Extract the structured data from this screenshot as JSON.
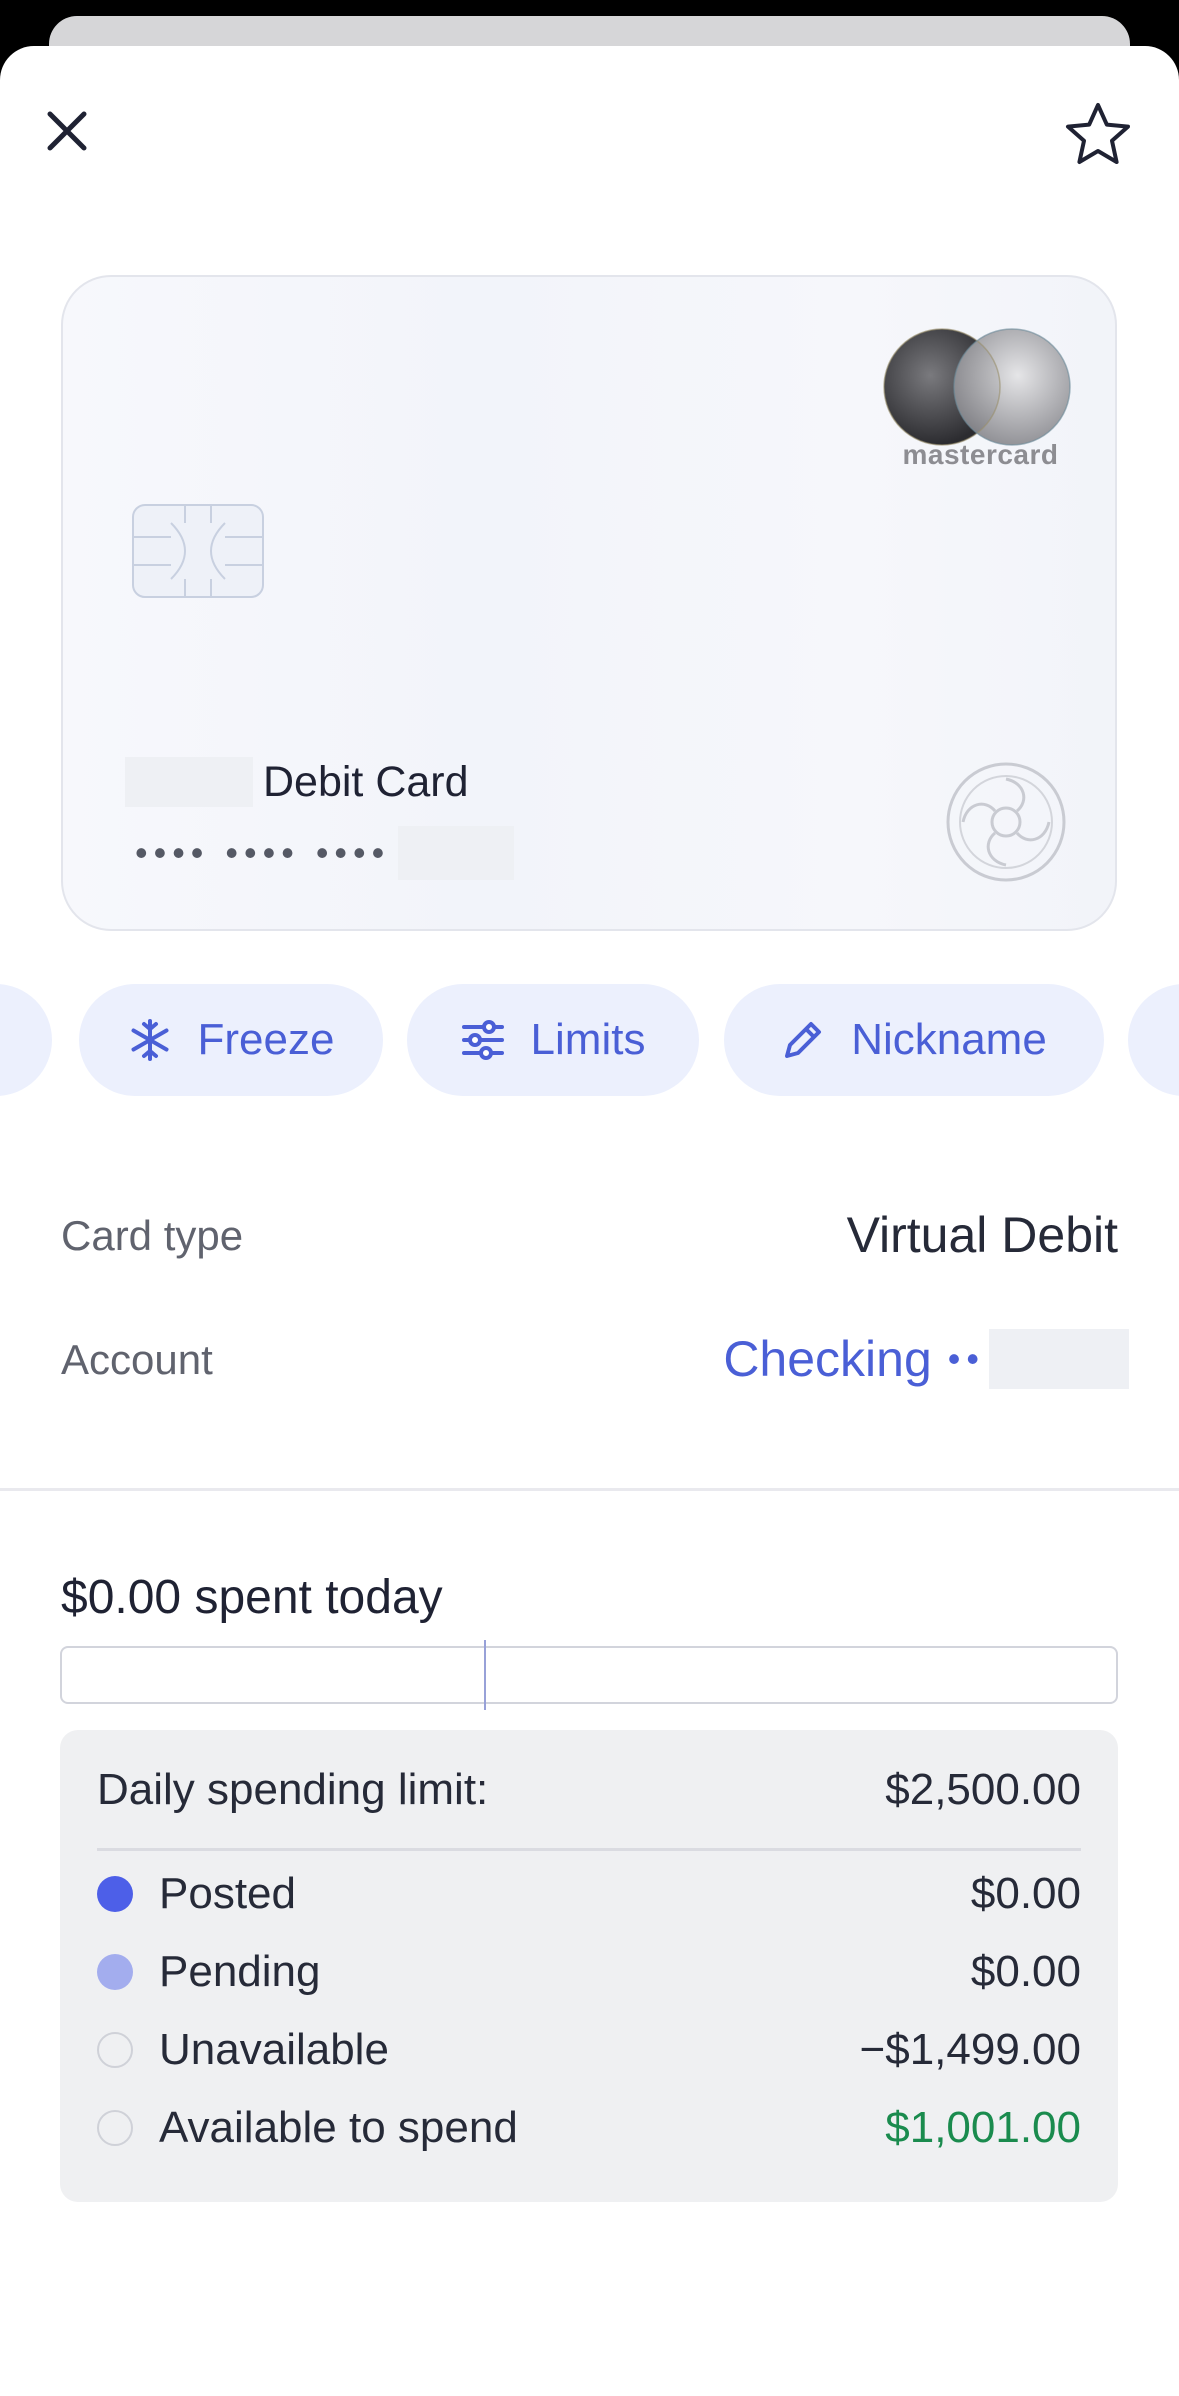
{
  "card": {
    "brand": "mastercard",
    "name_suffix": "Debit Card",
    "masked_number": "•••• •••• ••••"
  },
  "actions": [
    {
      "label": "Freeze",
      "icon": "snowflake-icon"
    },
    {
      "label": "Limits",
      "icon": "sliders-icon"
    },
    {
      "label": "Nickname",
      "icon": "pencil-icon"
    }
  ],
  "details": {
    "card_type_label": "Card type",
    "card_type_value": "Virtual Debit",
    "account_label": "Account",
    "account_value": "Checking",
    "account_dots": "••"
  },
  "spending": {
    "spent_today": "$0.00 spent today",
    "limit_label": "Daily spending limit:",
    "limit_value": "$2,500.00",
    "rows": [
      {
        "label": "Posted",
        "value": "$0.00"
      },
      {
        "label": "Pending",
        "value": "$0.00"
      },
      {
        "label": "Unavailable",
        "value": "−$1,499.00"
      },
      {
        "label": "Available to spend",
        "value": "$1,001.00"
      }
    ]
  },
  "colors": {
    "accent": "#4a5fd6",
    "pill_bg": "#ecf0fd",
    "posted": "#4d5fe8",
    "pending": "#a3adee",
    "available": "#1a8b4e"
  }
}
